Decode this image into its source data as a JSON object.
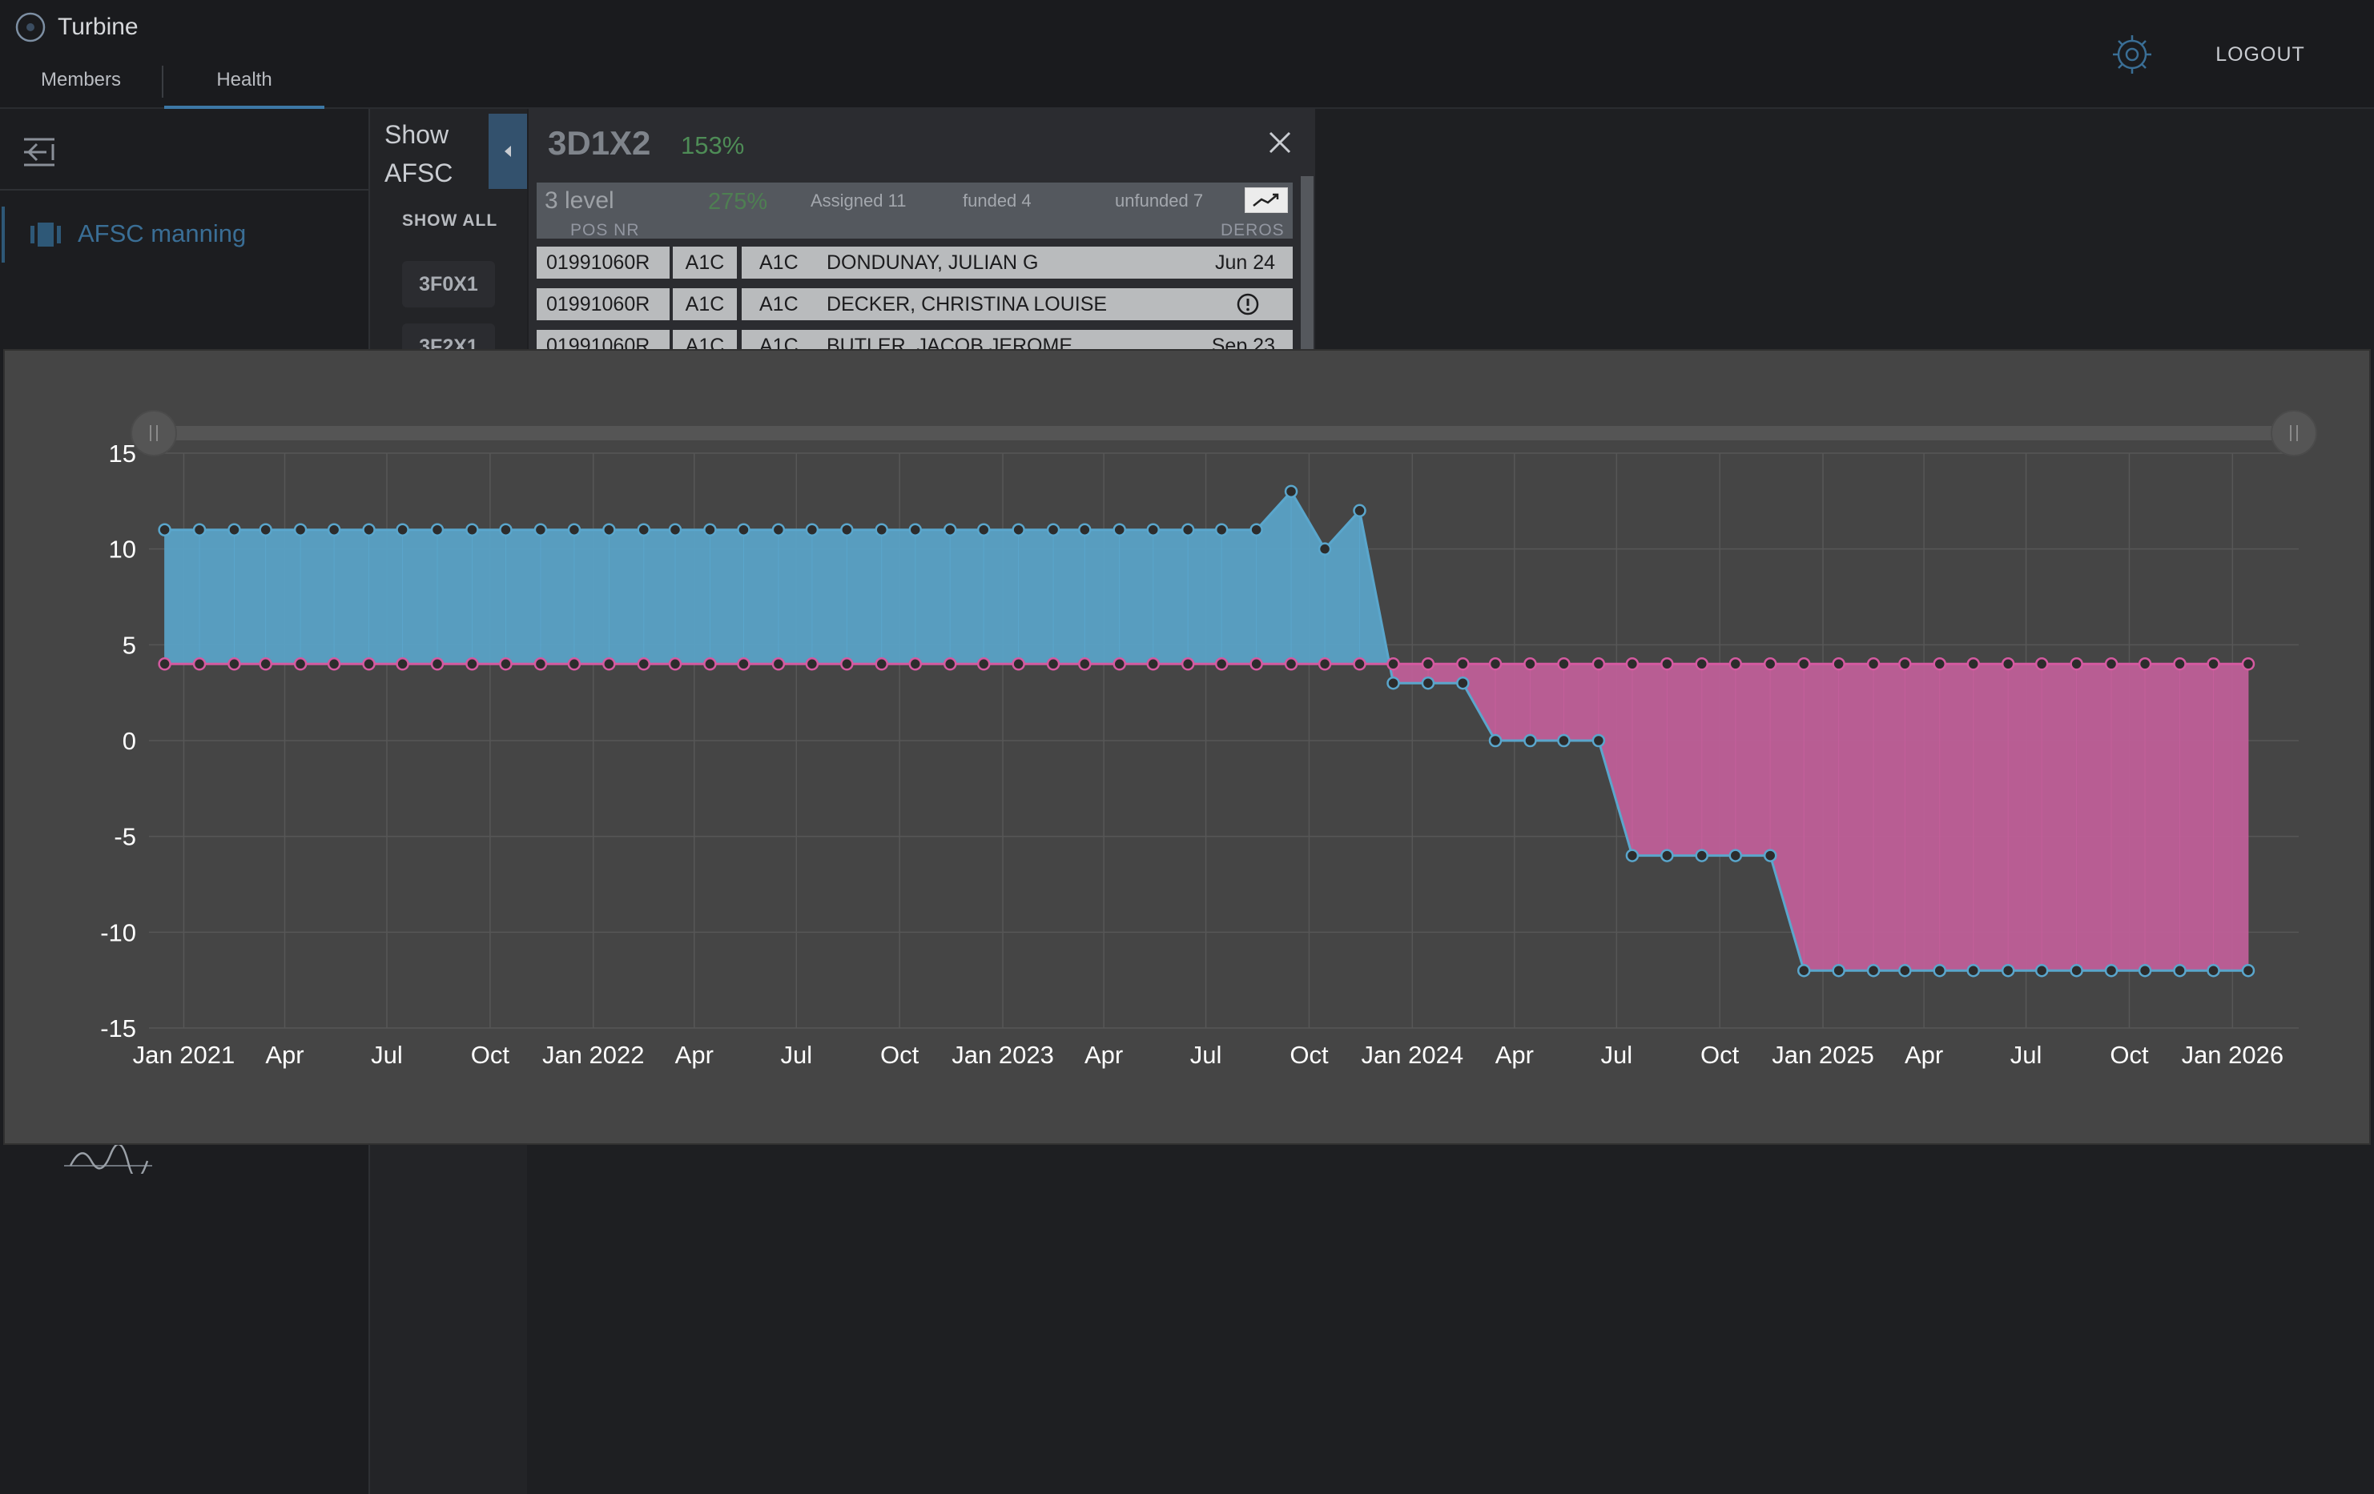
{
  "app": {
    "title": "Turbine"
  },
  "nav": {
    "tabs": [
      {
        "label": "Members"
      },
      {
        "label": "Health"
      }
    ],
    "active": "Health"
  },
  "header": {
    "logout_label": "LOGOUT"
  },
  "sidebar": {
    "items": [
      {
        "label": "AFSC manning",
        "icon": "roster-icon"
      }
    ]
  },
  "afsc_list": {
    "toggle_label": "Show AFSC",
    "show_all_label": "SHOW ALL",
    "items": [
      {
        "code": "3F0X1"
      },
      {
        "code": "3F2X1"
      }
    ]
  },
  "detail": {
    "afsc": "3D1X2",
    "percent": "153%",
    "level": {
      "name": "3 level",
      "percent": "275%",
      "assigned": "Assigned 11",
      "funded": "funded 4",
      "unfunded": "unfunded 7"
    },
    "columns": {
      "pos_nr": "POS NR",
      "deros": "DEROS"
    },
    "rows": [
      {
        "pos_nr": "01991060R",
        "grade": "A1C",
        "grade2": "A1C",
        "name": "DONDUNAY, JULIAN G",
        "deros": "Jun 24"
      },
      {
        "pos_nr": "01991060R",
        "grade": "A1C",
        "grade2": "A1C",
        "name": "DECKER, CHRISTINA LOUISE",
        "deros": ""
      },
      {
        "pos_nr": "01991060R",
        "grade": "A1C",
        "grade2": "A1C",
        "name": "BUTLER, JACOB JEROME",
        "deros": "Sep 23"
      }
    ]
  },
  "chart_data": {
    "type": "area",
    "ylim": [
      -15,
      15
    ],
    "yticks": [
      15,
      10,
      5,
      0,
      -5,
      -10,
      -15
    ],
    "xlim": [
      "2020-12-01",
      "2026-03-01"
    ],
    "xticks": [
      "Jan 2021",
      "Apr",
      "Jul",
      "Oct",
      "Jan 2022",
      "Apr",
      "Jul",
      "Oct",
      "Jan 2023",
      "Apr",
      "Jul",
      "Oct",
      "Jan 2024",
      "Apr",
      "Jul",
      "Oct",
      "Jan 2025",
      "Apr",
      "Jul",
      "Oct",
      "Jan 2026"
    ],
    "xtick_dates": [
      "2021-01-01",
      "2021-04-01",
      "2021-07-01",
      "2021-10-01",
      "2022-01-01",
      "2022-04-01",
      "2022-07-01",
      "2022-10-01",
      "2023-01-01",
      "2023-04-01",
      "2023-07-01",
      "2023-10-01",
      "2024-01-01",
      "2024-04-01",
      "2024-07-01",
      "2024-10-01",
      "2025-01-01",
      "2025-04-01",
      "2025-07-01",
      "2025-10-01",
      "2026-01-01"
    ],
    "grid": true,
    "colors": {
      "above": "#5aa6cc",
      "below": "#c45f9b",
      "assigned_line": "#5aa6cc",
      "funded_line": "#d45aa0"
    },
    "series": [
      {
        "name": "assigned",
        "x": [
          "2020-12-15",
          "2021-01-15",
          "2021-02-15",
          "2021-03-15",
          "2021-04-15",
          "2021-05-15",
          "2021-06-15",
          "2021-07-15",
          "2021-08-15",
          "2021-09-15",
          "2021-10-15",
          "2021-11-15",
          "2021-12-15",
          "2022-01-15",
          "2022-02-15",
          "2022-03-15",
          "2022-04-15",
          "2022-05-15",
          "2022-06-15",
          "2022-07-15",
          "2022-08-15",
          "2022-09-15",
          "2022-10-15",
          "2022-11-15",
          "2022-12-15",
          "2023-01-15",
          "2023-02-15",
          "2023-03-15",
          "2023-04-15",
          "2023-05-15",
          "2023-06-15",
          "2023-07-15",
          "2023-08-15",
          "2023-09-15",
          "2023-10-15",
          "2023-11-15",
          "2023-12-15",
          "2024-01-15",
          "2024-02-15",
          "2024-03-15",
          "2024-04-15",
          "2024-05-15",
          "2024-06-15",
          "2024-07-15",
          "2024-08-15",
          "2024-09-15",
          "2024-10-15",
          "2024-11-15",
          "2024-12-15",
          "2025-01-15",
          "2025-02-15",
          "2025-03-15",
          "2025-04-15",
          "2025-05-15",
          "2025-06-15",
          "2025-07-15",
          "2025-08-15",
          "2025-09-15",
          "2025-10-15",
          "2025-11-15",
          "2025-12-15",
          "2026-01-15"
        ],
        "values": [
          11,
          11,
          11,
          11,
          11,
          11,
          11,
          11,
          11,
          11,
          11,
          11,
          11,
          11,
          11,
          11,
          11,
          11,
          11,
          11,
          11,
          11,
          11,
          11,
          11,
          11,
          11,
          11,
          11,
          11,
          11,
          11,
          11,
          13,
          10,
          12,
          3,
          3,
          3,
          0,
          0,
          0,
          0,
          -6,
          -6,
          -6,
          -6,
          -6,
          -12,
          -12,
          -12,
          -12,
          -12,
          -12,
          -12,
          -12,
          -12,
          -12,
          -12,
          -12,
          -12,
          -12
        ]
      },
      {
        "name": "funded",
        "x": [
          "2020-12-15",
          "2021-01-15",
          "2021-02-15",
          "2021-03-15",
          "2021-04-15",
          "2021-05-15",
          "2021-06-15",
          "2021-07-15",
          "2021-08-15",
          "2021-09-15",
          "2021-10-15",
          "2021-11-15",
          "2021-12-15",
          "2022-01-15",
          "2022-02-15",
          "2022-03-15",
          "2022-04-15",
          "2022-05-15",
          "2022-06-15",
          "2022-07-15",
          "2022-08-15",
          "2022-09-15",
          "2022-10-15",
          "2022-11-15",
          "2022-12-15",
          "2023-01-15",
          "2023-02-15",
          "2023-03-15",
          "2023-04-15",
          "2023-05-15",
          "2023-06-15",
          "2023-07-15",
          "2023-08-15",
          "2023-09-15",
          "2023-10-15",
          "2023-11-15",
          "2023-12-15",
          "2024-01-15",
          "2024-02-15",
          "2024-03-15",
          "2024-04-15",
          "2024-05-15",
          "2024-06-15",
          "2024-07-15",
          "2024-08-15",
          "2024-09-15",
          "2024-10-15",
          "2024-11-15",
          "2024-12-15",
          "2025-01-15",
          "2025-02-15",
          "2025-03-15",
          "2025-04-15",
          "2025-05-15",
          "2025-06-15",
          "2025-07-15",
          "2025-08-15",
          "2025-09-15",
          "2025-10-15",
          "2025-11-15",
          "2025-12-15",
          "2026-01-15"
        ],
        "values": [
          4,
          4,
          4,
          4,
          4,
          4,
          4,
          4,
          4,
          4,
          4,
          4,
          4,
          4,
          4,
          4,
          4,
          4,
          4,
          4,
          4,
          4,
          4,
          4,
          4,
          4,
          4,
          4,
          4,
          4,
          4,
          4,
          4,
          4,
          4,
          4,
          4,
          4,
          4,
          4,
          4,
          4,
          4,
          4,
          4,
          4,
          4,
          4,
          4,
          4,
          4,
          4,
          4,
          4,
          4,
          4,
          4,
          4,
          4,
          4,
          4,
          4
        ]
      }
    ]
  }
}
